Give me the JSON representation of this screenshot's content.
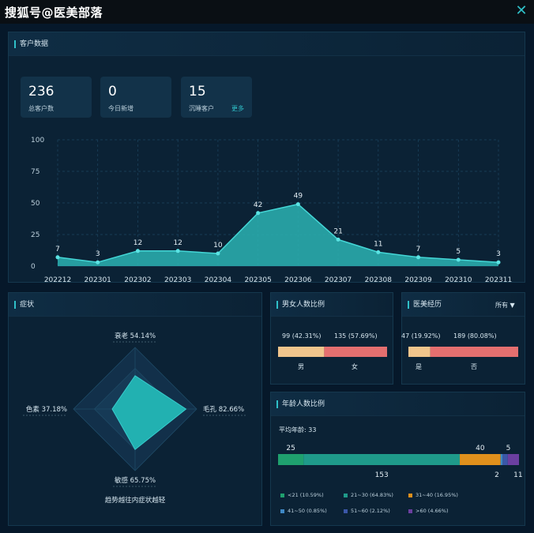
{
  "watermark": "搜狐号@医美部落",
  "customer_panel": {
    "title": "客户数据",
    "stats": [
      {
        "value": "236",
        "label": "总客户数"
      },
      {
        "value": "0",
        "label": "今日新增"
      },
      {
        "value": "15",
        "label": "沉睡客户"
      }
    ],
    "more": "更多"
  },
  "chart_data": [
    {
      "type": "area",
      "x": [
        "202212",
        "202301",
        "202302",
        "202303",
        "202304",
        "202305",
        "202306",
        "202307",
        "202308",
        "202309",
        "202310",
        "202311"
      ],
      "values": [
        7,
        3,
        12,
        12,
        10,
        42,
        49,
        21,
        11,
        7,
        5,
        3
      ],
      "y_ticks": [
        "0",
        "25",
        "50",
        "75",
        "100"
      ],
      "ylim": [
        0,
        100
      ],
      "grid": true,
      "color": "#2bb3b3"
    },
    {
      "type": "radar",
      "axes": [
        {
          "label": "衰老 54.14%",
          "value": 54.14
        },
        {
          "label": "毛孔 82.66%",
          "value": 82.66
        },
        {
          "label": "敏感 65.75%",
          "value": 65.75
        },
        {
          "label": "色素 37.18%",
          "value": 37.18
        }
      ],
      "footer": "趋势越往内症状越轻"
    },
    {
      "type": "bar",
      "title": "男女人数比例",
      "segments": [
        {
          "label": "男",
          "value": 99,
          "text": "99 (42.31%)",
          "fraction": 0.4231,
          "color": "#f0c58c"
        },
        {
          "label": "女",
          "value": 135,
          "text": "135 (57.69%)",
          "fraction": 0.5769,
          "color": "#e46f6f"
        }
      ]
    },
    {
      "type": "bar",
      "title": "医美经历",
      "filter": "所有 ▼",
      "segments": [
        {
          "label": "是",
          "value": 47,
          "text": "47 (19.92%)",
          "fraction": 0.1992,
          "color": "#f0c58c"
        },
        {
          "label": "否",
          "value": 189,
          "text": "189 (80.08%)",
          "fraction": 0.8008,
          "color": "#e46f6f"
        }
      ]
    },
    {
      "type": "bar",
      "title": "年龄人数比例",
      "subtitle": "平均年龄: 33",
      "segments": [
        {
          "value": 25,
          "fraction": 0.1059,
          "color": "#1fa06e",
          "legend": "<21 (10.59%)"
        },
        {
          "value": 153,
          "fraction": 0.6483,
          "color": "#1f9a8a",
          "legend": "21~30 (64.83%)"
        },
        {
          "value": 40,
          "fraction": 0.1695,
          "color": "#e0901c",
          "legend": "31~40 (16.95%)"
        },
        {
          "value": 2,
          "fraction": 0.0085,
          "color": "#3f88c5",
          "legend": "41~50 (0.85%)"
        },
        {
          "value": 5,
          "fraction": 0.0212,
          "color": "#3b57a8",
          "legend": "51~60 (2.12%)"
        },
        {
          "value": 11,
          "fraction": 0.0466,
          "color": "#6b3fa0",
          "legend": ">60 (4.66%)"
        }
      ]
    }
  ],
  "symptom_panel": {
    "title": "症状"
  },
  "icons": {
    "close": "close-icon"
  }
}
